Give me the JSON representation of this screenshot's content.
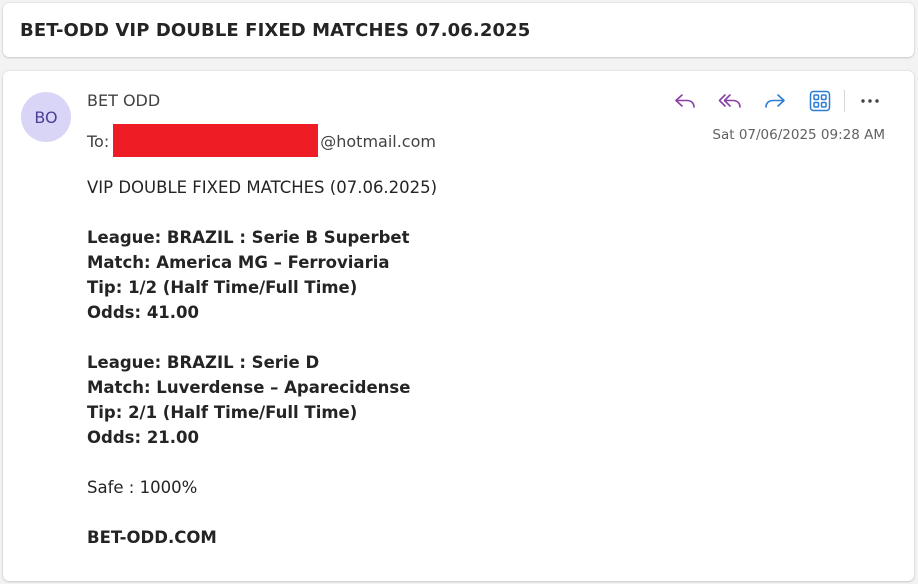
{
  "subject": "BET-ODD VIP DOUBLE FIXED MATCHES 07.06.2025",
  "message": {
    "avatar_initials": "BO",
    "sender": "BET ODD",
    "to_label": "To:",
    "to_email_suffix": "@hotmail.com",
    "timestamp": "Sat 07/06/2025 09:28 AM"
  },
  "toolbar": {
    "icons": [
      "reply-icon",
      "reply-all-icon",
      "forward-icon",
      "apps-icon",
      "more-options-icon"
    ],
    "colors": {
      "reply": "#8a3ea8",
      "forward": "#2b7cd3",
      "apps": "#2b7cd3"
    }
  },
  "body": {
    "intro": "VIP DOUBLE FIXED MATCHES (07.06.2025)",
    "match1": {
      "league": "League: BRAZIL : Serie B Superbet",
      "match": "Match: America MG – Ferroviaria",
      "tip": "Tip: 1/2 (Half Time/Full Time)",
      "odds": "Odds: 41.00"
    },
    "match2": {
      "league": "League: BRAZIL : Serie D",
      "match": "Match: Luverdense – Aparecidense",
      "tip": "Tip: 2/1 (Half Time/Full Time)",
      "odds": "Odds: 21.00"
    },
    "safe": "Safe : 1000%",
    "site": "BET-ODD.COM"
  }
}
